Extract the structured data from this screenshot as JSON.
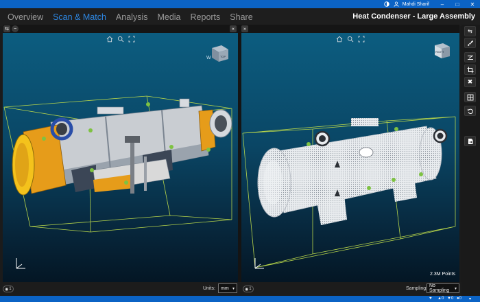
{
  "titlebar": {
    "user_name": "Mahdi Sharif"
  },
  "menu": {
    "tabs": [
      {
        "label": "Overview"
      },
      {
        "label": "Scan & Match"
      },
      {
        "label": "Analysis"
      },
      {
        "label": "Media"
      },
      {
        "label": "Reports"
      },
      {
        "label": "Share"
      }
    ],
    "active_tab": "Scan & Match",
    "document_title": "Heat Condenser - Large Assembly"
  },
  "viewport_left": {
    "nav_cube_label": "TOP",
    "nav_cube_compass": "W"
  },
  "viewport_right": {
    "nav_cube_label": "RIGHT",
    "points_count": "2.3M Points"
  },
  "bottom_left": {
    "counter_label": "1",
    "units_label": "Units:",
    "units_value": "mm"
  },
  "bottom_right": {
    "counter_label": "1",
    "sampling_label": "Sampling:",
    "sampling_value": "No Sampling"
  },
  "statusbar": {
    "count_a": "0",
    "count_b": "0",
    "count_c": "0"
  },
  "colors": {
    "accent": "#0b63c5",
    "active_tab": "#2d86e0",
    "bbox_line": "#b8d64a"
  }
}
